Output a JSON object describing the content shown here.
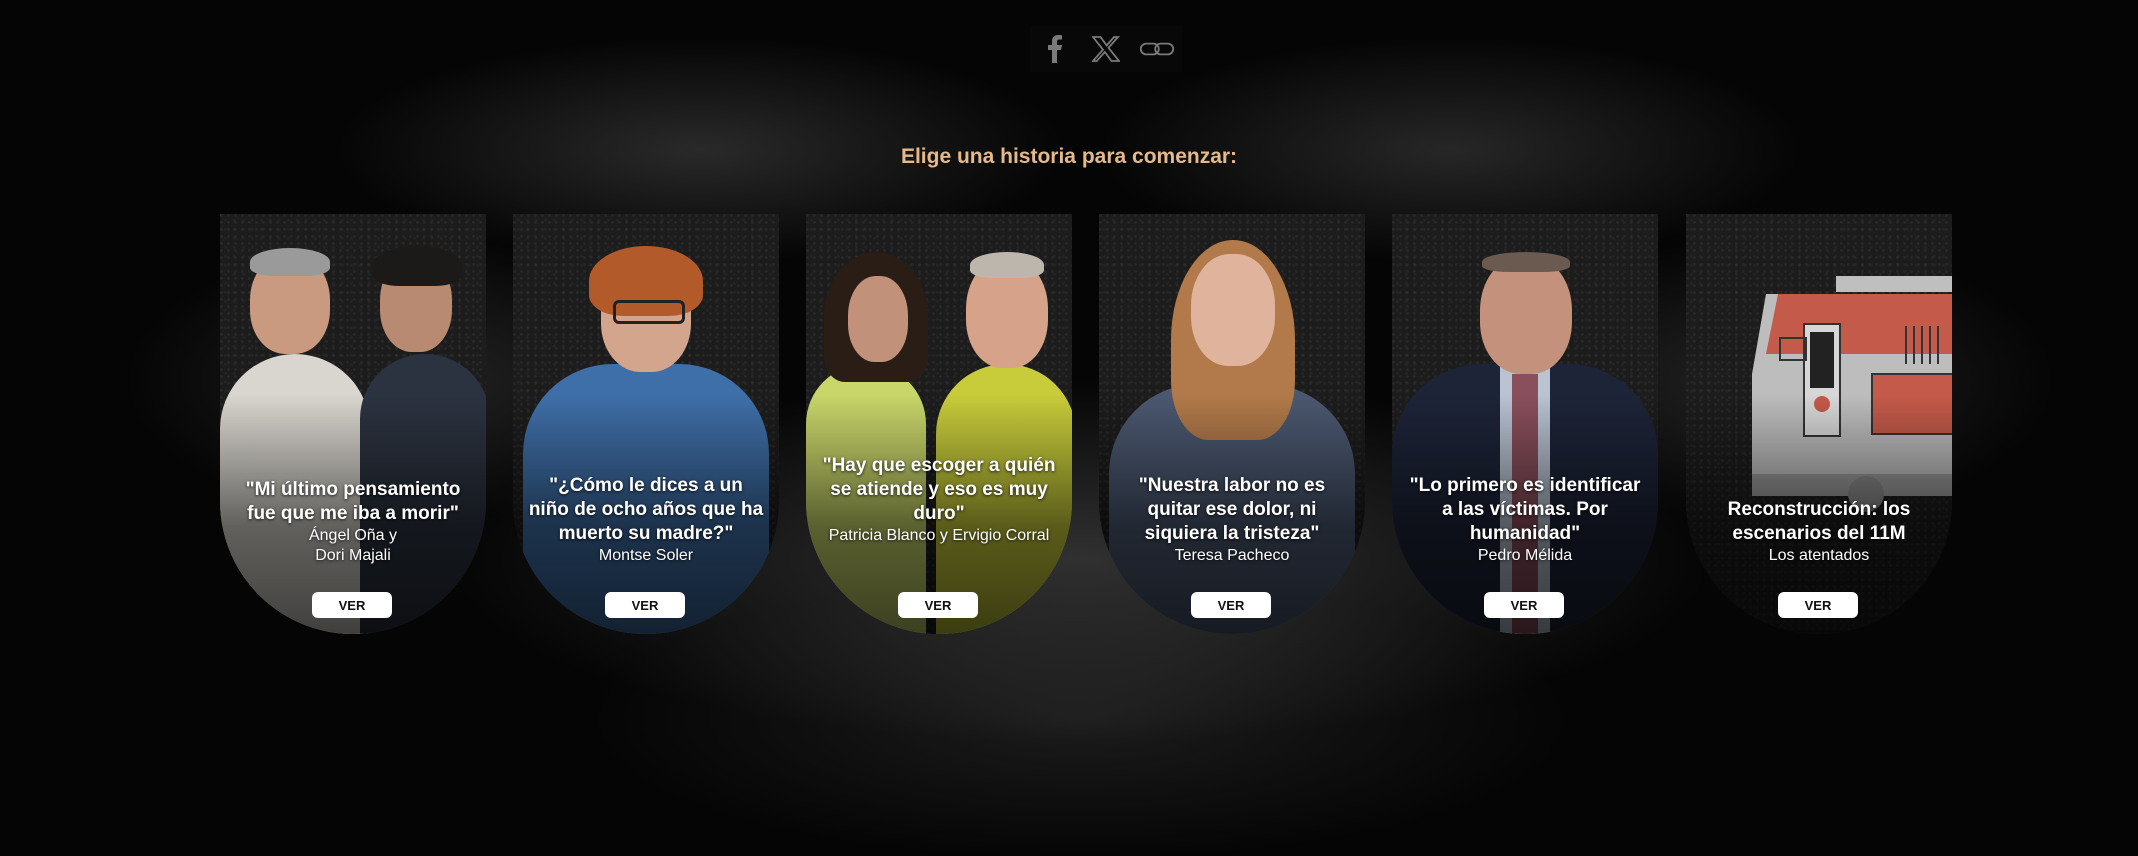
{
  "share": {
    "items": [
      {
        "name": "facebook",
        "icon": "facebook-icon"
      },
      {
        "name": "x",
        "icon": "x-icon"
      },
      {
        "name": "link",
        "icon": "link-icon"
      }
    ]
  },
  "prompt": "Elige una historia para comenzar:",
  "colors": {
    "prompt": "#e6b98a",
    "button_bg": "#ffffff",
    "background": "#000000"
  },
  "cards": [
    {
      "quote": "\"Mi último pensamiento fue que me iba a morir\"",
      "names": "Ángel Oña y Dori Majali",
      "button": "VER"
    },
    {
      "quote": "\"¿Cómo le dices a un niño de ocho años que ha muerto su madre?\"",
      "names": "Montse Soler",
      "button": "VER"
    },
    {
      "quote": "\"Hay que escoger a quién se atiende y eso es muy duro\"",
      "names": "Patricia Blanco y Ervigio Corral",
      "button": "VER"
    },
    {
      "quote": "\"Nuestra labor no es quitar ese dolor, ni siquiera la tristeza\"",
      "names": "Teresa Pacheco",
      "button": "VER"
    },
    {
      "quote": "\"Lo primero es identificar a las víctimas. Por humanidad\"",
      "names": "Pedro Mélida",
      "button": "VER"
    },
    {
      "quote": "Reconstrucción: los escenarios del 11M",
      "names": "Los atentados",
      "button": "VER"
    }
  ]
}
